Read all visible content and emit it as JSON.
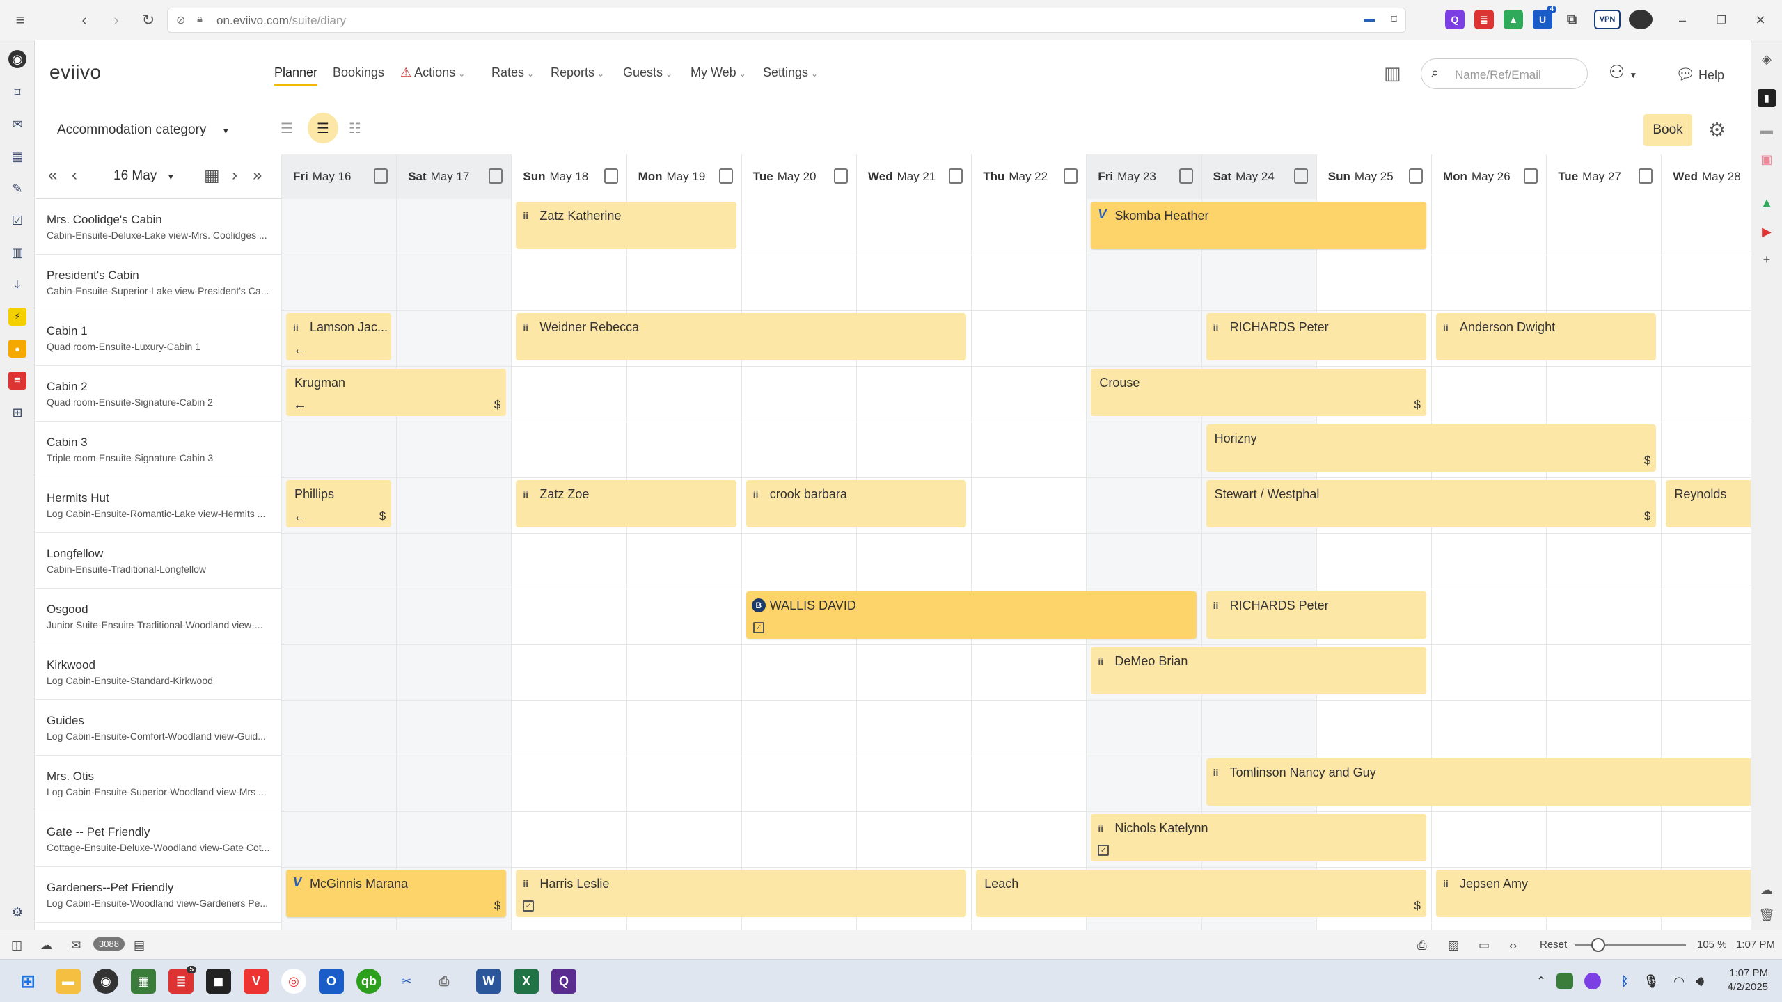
{
  "browser": {
    "url_host": "on.eviivo.com",
    "url_path": "/suite/diary",
    "ext_badge": "4",
    "vpn": "VPN"
  },
  "app": {
    "logo": "eviivo",
    "nav": [
      {
        "label": "Planner"
      },
      {
        "label": "Bookings"
      },
      {
        "label": "Actions"
      },
      {
        "label": "Rates"
      },
      {
        "label": "Reports"
      },
      {
        "label": "Guests"
      },
      {
        "label": "My Web"
      },
      {
        "label": "Settings"
      }
    ],
    "search_placeholder": "Name/Ref/Email",
    "help": "Help"
  },
  "toolbar": {
    "category_select": "Accommodation category",
    "date_select": "16 May",
    "book_label": "Book"
  },
  "days": [
    {
      "dow": "Fri",
      "date": "May 16",
      "weekend": true
    },
    {
      "dow": "Sat",
      "date": "May 17",
      "weekend": true
    },
    {
      "dow": "Sun",
      "date": "May 18",
      "weekend": false
    },
    {
      "dow": "Mon",
      "date": "May 19",
      "weekend": false
    },
    {
      "dow": "Tue",
      "date": "May 20",
      "weekend": false
    },
    {
      "dow": "Wed",
      "date": "May 21",
      "weekend": false
    },
    {
      "dow": "Thu",
      "date": "May 22",
      "weekend": false
    },
    {
      "dow": "Fri",
      "date": "May 23",
      "weekend": true
    },
    {
      "dow": "Sat",
      "date": "May 24",
      "weekend": true
    },
    {
      "dow": "Sun",
      "date": "May 25",
      "weekend": false
    },
    {
      "dow": "Mon",
      "date": "May 26",
      "weekend": false
    },
    {
      "dow": "Tue",
      "date": "May 27",
      "weekend": false
    },
    {
      "dow": "Wed",
      "date": "May 28",
      "weekend": false
    }
  ],
  "rooms": [
    {
      "name": "Mrs. Coolidge's Cabin",
      "desc": "Cabin-Ensuite-Deluxe-Lake view-Mrs. Coolidges ..."
    },
    {
      "name": "President's Cabin",
      "desc": "Cabin-Ensuite-Superior-Lake view-President's Ca..."
    },
    {
      "name": "Cabin 1",
      "desc": "Quad room-Ensuite-Luxury-Cabin 1"
    },
    {
      "name": "Cabin 2",
      "desc": "Quad room-Ensuite-Signature-Cabin 2"
    },
    {
      "name": "Cabin 3",
      "desc": "Triple room-Ensuite-Signature-Cabin 3"
    },
    {
      "name": "Hermits Hut",
      "desc": "Log Cabin-Ensuite-Romantic-Lake view-Hermits ..."
    },
    {
      "name": "Longfellow",
      "desc": "Cabin-Ensuite-Traditional-Longfellow"
    },
    {
      "name": "Osgood",
      "desc": "Junior Suite-Ensuite-Traditional-Woodland view-..."
    },
    {
      "name": "Kirkwood",
      "desc": "Log Cabin-Ensuite-Standard-Kirkwood"
    },
    {
      "name": "Guides",
      "desc": "Log Cabin-Ensuite-Comfort-Woodland view-Guid..."
    },
    {
      "name": "Mrs. Otis",
      "desc": "Log Cabin-Ensuite-Superior-Woodland view-Mrs ..."
    },
    {
      "name": "Gate -- Pet Friendly",
      "desc": "Cottage-Ensuite-Deluxe-Woodland view-Gate Cot..."
    },
    {
      "name": "Gardeners--Pet Friendly",
      "desc": "Log Cabin-Ensuite-Woodland view-Gardeners Pe..."
    }
  ],
  "bookings": [
    {
      "row": 0,
      "start": 2,
      "span": 2,
      "name": "Zatz Katherine",
      "tag": "ii"
    },
    {
      "row": 0,
      "start": 7,
      "span": 3,
      "name": "Skomba Heather",
      "tag": "V",
      "strong": true
    },
    {
      "row": 2,
      "start": 0,
      "span": 1,
      "name": "Lamson Jac...",
      "tag": "ii",
      "arrow": true
    },
    {
      "row": 2,
      "start": 2,
      "span": 4,
      "name": "Weidner Rebecca",
      "tag": "ii"
    },
    {
      "row": 2,
      "start": 8,
      "span": 2,
      "name": "RICHARDS Peter",
      "tag": "ii"
    },
    {
      "row": 2,
      "start": 10,
      "span": 2,
      "name": "Anderson Dwight",
      "tag": "ii"
    },
    {
      "row": 3,
      "start": 0,
      "span": 2,
      "name": "Krugman",
      "arrow": true,
      "dollar": "$"
    },
    {
      "row": 3,
      "start": 7,
      "span": 3,
      "name": "Crouse",
      "dollar": "$"
    },
    {
      "row": 4,
      "start": 8,
      "span": 4,
      "name": "Horizny",
      "dollar": "$"
    },
    {
      "row": 5,
      "start": 0,
      "span": 1,
      "name": "Phillips",
      "arrow": true,
      "dollar": "$"
    },
    {
      "row": 5,
      "start": 2,
      "span": 2,
      "name": "Zatz Zoe",
      "tag": "ii"
    },
    {
      "row": 5,
      "start": 4,
      "span": 2,
      "name": "crook barbara",
      "tag": "ii"
    },
    {
      "row": 5,
      "start": 8,
      "span": 4,
      "name": "Stewart / Westphal",
      "dollar": "$"
    },
    {
      "row": 5,
      "start": 12,
      "span": 1,
      "name": "Reynolds",
      "open": true
    },
    {
      "row": 7,
      "start": 4,
      "span": 4,
      "name": "WALLIS DAVID",
      "tag": "B",
      "strong": true,
      "note": true
    },
    {
      "row": 7,
      "start": 8,
      "span": 2,
      "name": "RICHARDS Peter",
      "tag": "ii"
    },
    {
      "row": 8,
      "start": 7,
      "span": 3,
      "name": "DeMeo Brian",
      "tag": "ii"
    },
    {
      "row": 10,
      "start": 8,
      "span": 5,
      "name": "Tomlinson Nancy and Guy",
      "tag": "ii",
      "open": true
    },
    {
      "row": 11,
      "start": 7,
      "span": 3,
      "name": "Nichols Katelynn",
      "tag": "ii",
      "note": true
    },
    {
      "row": 12,
      "start": 0,
      "span": 2,
      "name": "McGinnis Marana",
      "tag": "V",
      "strong": true,
      "dollar": "$"
    },
    {
      "row": 12,
      "start": 2,
      "span": 4,
      "name": "Harris Leslie",
      "tag": "ii",
      "note": true
    },
    {
      "row": 12,
      "start": 6,
      "span": 4,
      "name": "Leach",
      "dollar": "$"
    },
    {
      "row": 12,
      "start": 10,
      "span": 3,
      "name": "Jepsen Amy",
      "tag": "ii",
      "open": true
    }
  ],
  "status": {
    "mail_count": "3088",
    "reset": "Reset",
    "zoom": "105 %",
    "time": "1:07 PM"
  },
  "taskbar": {
    "time": "1:07 PM",
    "date": "4/2/2025",
    "badge": "5"
  }
}
